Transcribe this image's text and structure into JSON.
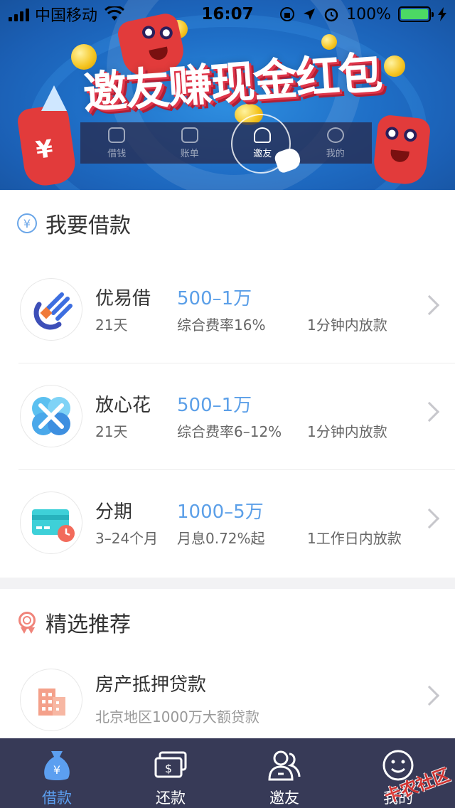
{
  "status_bar": {
    "carrier": "中国移动",
    "time": "16:07",
    "battery": "100%",
    "battery_color": "#4cd964"
  },
  "banner": {
    "title": "邀友赚现金红包",
    "tabs": [
      {
        "label": "借钱",
        "icon": "money-bag-icon"
      },
      {
        "label": "账单",
        "icon": "bill-icon"
      },
      {
        "label": "邀友",
        "icon": "invite-icon",
        "active": true
      },
      {
        "label": "我的",
        "icon": "smile-icon"
      }
    ]
  },
  "loan_section": {
    "title": "我要借款",
    "icon": "yen-circle-icon",
    "products": [
      {
        "name": "优易借",
        "term": "21天",
        "amount": "500–1万",
        "rate": "综合费率16%",
        "speed": "1分钟内放款",
        "icon": "youyijie-logo-icon"
      },
      {
        "name": "放心花",
        "term": "21天",
        "amount": "500–1万",
        "rate": "综合费率6–12%",
        "speed": "1分钟内放款",
        "icon": "fangxinhua-logo-icon"
      },
      {
        "name": "分期",
        "term": "3–24个月",
        "amount": "1000–5万",
        "rate": "月息0.72%起",
        "speed": "1工作日内放款",
        "icon": "card-clock-icon"
      }
    ]
  },
  "recommend_section": {
    "title": "精选推荐",
    "icon": "award-ribbon-icon",
    "items": [
      {
        "name": "房产抵押贷款",
        "desc": "北京地区1000万大额贷款",
        "icon": "building-icon"
      }
    ]
  },
  "tabbar": {
    "items": [
      {
        "label": "借款",
        "icon": "money-bag-icon",
        "active": true
      },
      {
        "label": "还款",
        "icon": "cash-stack-icon"
      },
      {
        "label": "邀友",
        "icon": "invite-friends-icon"
      },
      {
        "label": "我的",
        "icon": "smile-face-icon"
      }
    ],
    "active_color": "#5c9ff0",
    "background": "#373a57"
  },
  "watermark": "卡农社区"
}
